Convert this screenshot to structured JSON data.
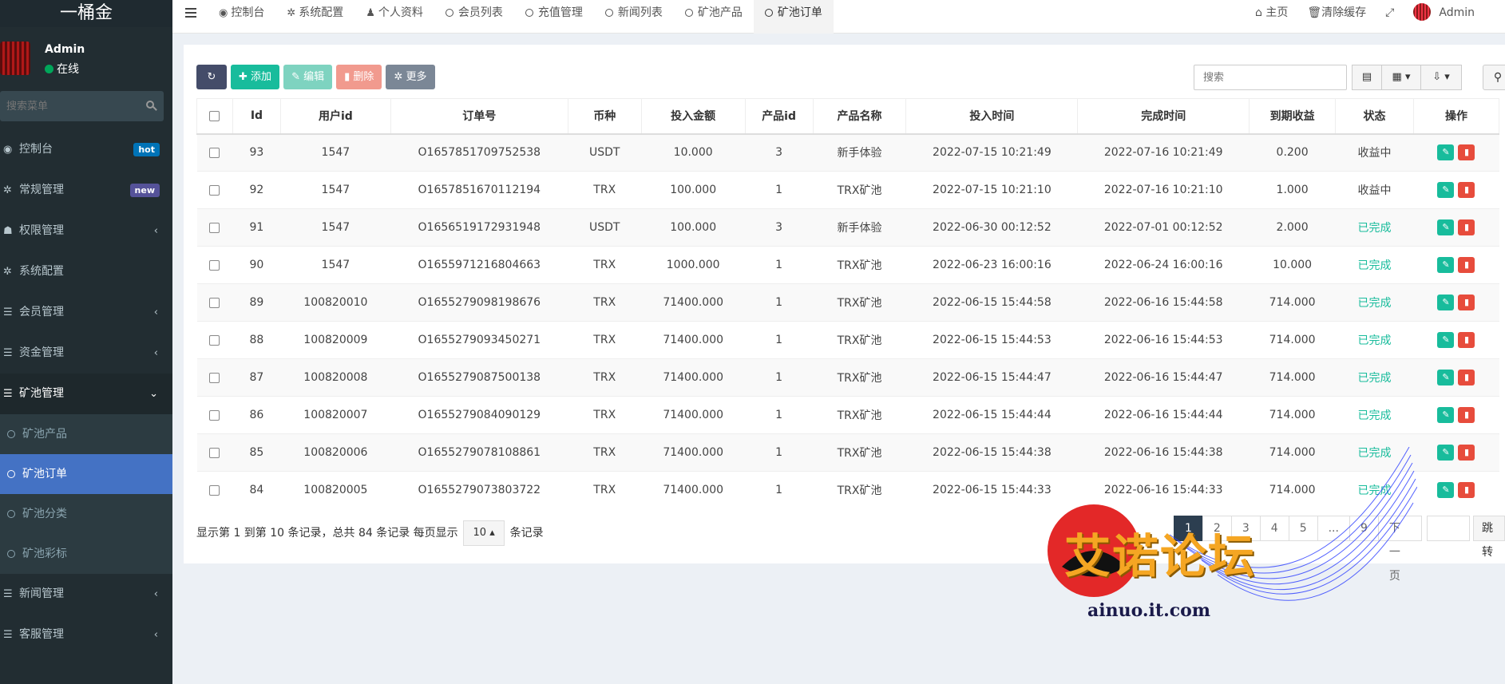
{
  "app": {
    "logo": "一桶金"
  },
  "user": {
    "name": "Admin",
    "status": "在线"
  },
  "sidebar": {
    "search_placeholder": "搜索菜单",
    "items": [
      {
        "label": "控制台",
        "icon": "dashboard-icon",
        "badge": "hot"
      },
      {
        "label": "常规管理",
        "icon": "cogs-icon",
        "badge": "new"
      },
      {
        "label": "权限管理",
        "icon": "group-icon"
      },
      {
        "label": "系统配置",
        "icon": "gear-icon"
      },
      {
        "label": "会员管理",
        "icon": "list-icon"
      },
      {
        "label": "资金管理",
        "icon": "list-icon"
      },
      {
        "label": "矿池管理",
        "icon": "list-icon"
      }
    ],
    "sub_items": [
      "矿池产品",
      "矿池订单",
      "矿池分类",
      "矿池彩标"
    ],
    "bottom_items": [
      {
        "label": "新闻管理",
        "icon": "list-icon"
      },
      {
        "label": "客服管理",
        "icon": "list-icon"
      }
    ]
  },
  "topnav": {
    "tabs": [
      "控制台",
      "系统配置",
      "个人资料",
      "会员列表",
      "充值管理",
      "新闻列表",
      "矿池产品",
      "矿池订单"
    ],
    "home": "主页",
    "clear_cache": "清除缓存",
    "admin": "Admin"
  },
  "toolbar": {
    "add": "添加",
    "edit": "编辑",
    "delete": "删除",
    "more": "更多",
    "search_placeholder": "搜索"
  },
  "table": {
    "headers": [
      "Id",
      "用户id",
      "订单号",
      "币种",
      "投入金额",
      "产品id",
      "产品名称",
      "投入时间",
      "完成时间",
      "到期收益",
      "状态",
      "操作"
    ],
    "rows": [
      [
        "93",
        "1547",
        "O1657851709752538",
        "USDT",
        "10.000",
        "3",
        "新手体验",
        "2022-07-15 10:21:49",
        "2022-07-16 10:21:49",
        "0.200",
        "收益中"
      ],
      [
        "92",
        "1547",
        "O1657851670112194",
        "TRX",
        "100.000",
        "1",
        "TRX矿池",
        "2022-07-15 10:21:10",
        "2022-07-16 10:21:10",
        "1.000",
        "收益中"
      ],
      [
        "91",
        "1547",
        "O1656519172931948",
        "USDT",
        "100.000",
        "3",
        "新手体验",
        "2022-06-30 00:12:52",
        "2022-07-01 00:12:52",
        "2.000",
        "已完成"
      ],
      [
        "90",
        "1547",
        "O1655971216804663",
        "TRX",
        "1000.000",
        "1",
        "TRX矿池",
        "2022-06-23 16:00:16",
        "2022-06-24 16:00:16",
        "10.000",
        "已完成"
      ],
      [
        "89",
        "100820010",
        "O1655279098198676",
        "TRX",
        "71400.000",
        "1",
        "TRX矿池",
        "2022-06-15 15:44:58",
        "2022-06-16 15:44:58",
        "714.000",
        "已完成"
      ],
      [
        "88",
        "100820009",
        "O1655279093450271",
        "TRX",
        "71400.000",
        "1",
        "TRX矿池",
        "2022-06-15 15:44:53",
        "2022-06-16 15:44:53",
        "714.000",
        "已完成"
      ],
      [
        "87",
        "100820008",
        "O1655279087500138",
        "TRX",
        "71400.000",
        "1",
        "TRX矿池",
        "2022-06-15 15:44:47",
        "2022-06-16 15:44:47",
        "714.000",
        "已完成"
      ],
      [
        "86",
        "100820007",
        "O1655279084090129",
        "TRX",
        "71400.000",
        "1",
        "TRX矿池",
        "2022-06-15 15:44:44",
        "2022-06-16 15:44:44",
        "714.000",
        "已完成"
      ],
      [
        "85",
        "100820006",
        "O1655279078108861",
        "TRX",
        "71400.000",
        "1",
        "TRX矿池",
        "2022-06-15 15:44:38",
        "2022-06-16 15:44:38",
        "714.000",
        "已完成"
      ],
      [
        "84",
        "100820005",
        "O1655279073803722",
        "TRX",
        "71400.000",
        "1",
        "TRX矿池",
        "2022-06-15 15:44:33",
        "2022-06-16 15:44:33",
        "714.000",
        "已完成"
      ]
    ]
  },
  "pager": {
    "info_prefix": "显示第 1 到第 10 条记录，总共 84 条记录 每页显示",
    "page_size": "10",
    "info_suffix": "条记录",
    "pages": [
      "1",
      "2",
      "3",
      "4",
      "5",
      "...",
      "9"
    ],
    "next": "下一页",
    "go": "跳转"
  },
  "watermark": {
    "text": "艾诺论坛",
    "url": "ainuo.it.com"
  },
  "colors": {
    "sidebar": "#222d32",
    "active": "#4472c4",
    "success": "#18bc9c",
    "danger": "#e74c3c"
  }
}
